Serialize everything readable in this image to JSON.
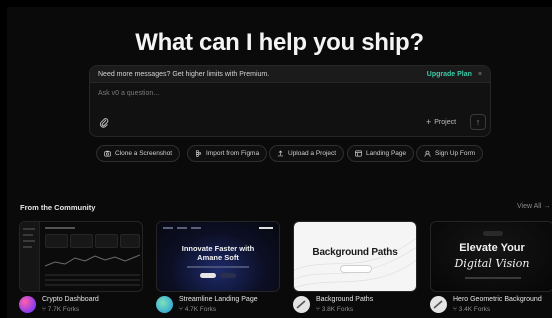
{
  "headline": "What can I help you ship?",
  "prompt": {
    "banner_text": "Need more messages? Get higher limits with Premium.",
    "upgrade_label": "Upgrade Plan",
    "close_glyph": "×",
    "placeholder": "Ask v0 a question...",
    "project_label": "Project",
    "project_icon": "+",
    "send_icon": "↑"
  },
  "quick_actions": [
    {
      "label": "Clone a Screenshot",
      "icon": "camera-icon"
    },
    {
      "label": "Import from Figma",
      "icon": "figma-icon"
    },
    {
      "label": "Upload a Project",
      "icon": "upload-icon"
    },
    {
      "label": "Landing Page",
      "icon": "layout-icon"
    },
    {
      "label": "Sign Up Form",
      "icon": "user-plus-icon"
    }
  ],
  "community": {
    "title": "From the Community",
    "view_all": "View All →"
  },
  "cards": [
    {
      "title": "Crypto Dashboard",
      "forks": "7.7K Forks",
      "avatar_color": "#8a3cf0"
    },
    {
      "title": "Streamline Landing Page",
      "forks": "4.7K Forks",
      "avatar_color": "#3fcf8e",
      "preview_title": "Innovate Faster with Amane Soft"
    },
    {
      "title": "Background Paths",
      "forks": "3.8K Forks",
      "avatar_color": "#d9d9d9",
      "preview_title": "Background Paths"
    },
    {
      "title": "Hero Geometric Background",
      "forks": "3.4K Forks",
      "avatar_color": "#d9d9d9",
      "preview_line1": "Elevate Your",
      "preview_line2": "Digital Vision"
    }
  ],
  "colors": {
    "background": "#0a0a0a",
    "accent": "#3ec9a7"
  }
}
